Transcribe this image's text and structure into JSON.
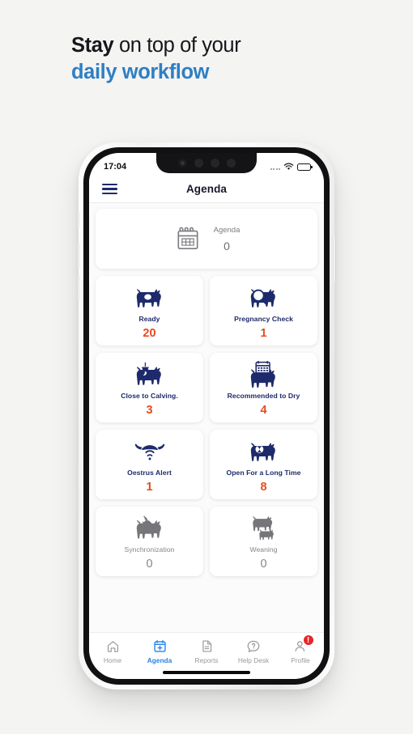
{
  "headline": {
    "line1_bold": "Stay",
    "line1_rest": " on top of your",
    "line2": "daily workflow"
  },
  "status_bar": {
    "time": "17:04",
    "wifi_icon": "wifi-icon",
    "battery_icon": "battery-icon",
    "signal_dots_icon": "signal-dots-icon"
  },
  "header": {
    "menu_icon": "hamburger-menu-icon",
    "title": "Agenda"
  },
  "agenda_card": {
    "icon": "calendar-icon",
    "label": "Agenda",
    "value": "0"
  },
  "tiles": [
    {
      "label": "Ready",
      "value": "20",
      "icon": "cow-egg-icon",
      "state": "active"
    },
    {
      "label": "Pregnancy Check",
      "value": "1",
      "icon": "cow-magnifier-icon",
      "state": "active"
    },
    {
      "label": "Close to Calving.",
      "value": "3",
      "icon": "cow-calving-icon",
      "state": "active"
    },
    {
      "label": "Recommended to Dry",
      "value": "4",
      "icon": "cow-calendar-icon",
      "state": "active"
    },
    {
      "label": "Oestrus Alert",
      "value": "1",
      "icon": "bull-head-signal-icon",
      "state": "active"
    },
    {
      "label": "Open For a Long Time",
      "value": "8",
      "icon": "cow-clock-icon",
      "state": "active"
    },
    {
      "label": "Synchronization",
      "value": "0",
      "icon": "cow-syringe-icon",
      "state": "disabled"
    },
    {
      "label": "Weaning",
      "value": "0",
      "icon": "cow-calf-icon",
      "state": "disabled"
    }
  ],
  "tabs": [
    {
      "label": "Home",
      "icon": "home-icon",
      "active": false,
      "badge": ""
    },
    {
      "label": "Agenda",
      "icon": "calendar-plus-icon",
      "active": true,
      "badge": ""
    },
    {
      "label": "Reports",
      "icon": "document-icon",
      "active": false,
      "badge": ""
    },
    {
      "label": "Help Desk",
      "icon": "chat-question-icon",
      "active": false,
      "badge": ""
    },
    {
      "label": "Profile",
      "icon": "person-icon",
      "active": false,
      "badge": "!"
    }
  ],
  "colors": {
    "page_bg": "#f4f4f3",
    "headline_dark": "#15171a",
    "headline_blue": "#2f7fc4",
    "navy": "#1d2a6b",
    "orange": "#e8491e",
    "tab_active": "#2481e8",
    "badge_red": "#e8252a",
    "muted_gray": "#86868a"
  }
}
